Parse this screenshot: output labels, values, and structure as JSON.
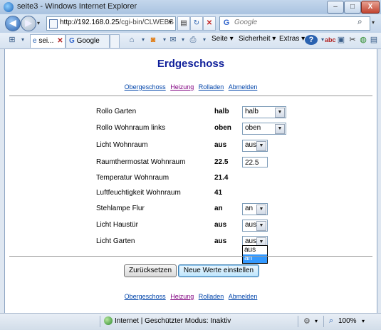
{
  "window": {
    "title": "seite3 - Windows Internet Explorer",
    "controls": {
      "minimize": "–",
      "maximize": "□",
      "close": "X"
    }
  },
  "addressbar": {
    "url_host": "http://192.168.0.25",
    "url_path": "/cgi-bin/CLWEBS",
    "search_placeholder": "Google"
  },
  "tabs": [
    {
      "label": "sei..."
    },
    {
      "label": "Google"
    }
  ],
  "commandbar": {
    "page": "Seite ▾",
    "safety": "Sicherheit ▾",
    "extras": "Extras ▾",
    "help": "?▾"
  },
  "page": {
    "heading": "Erdgeschoss",
    "nav": [
      "Obergeschoss",
      "Heizung",
      "Rolladen",
      "Abmelden"
    ],
    "rows": [
      {
        "label": "Rollo Garten",
        "value": "halb",
        "control": "select",
        "selected": "halb"
      },
      {
        "label": "Rollo Wohnraum links",
        "value": "oben",
        "control": "select",
        "selected": "oben"
      },
      {
        "label": "Licht Wohnraum",
        "value": "aus",
        "control": "select",
        "selected": "aus"
      },
      {
        "label": "Raumthermostat Wohnraum",
        "value": "22.5",
        "control": "text",
        "input_value": "22.5"
      },
      {
        "label": "Temperatur Wohnraum",
        "value": "21.4",
        "control": "none"
      },
      {
        "label": "Luftfeuchtigkeit Wohnraum",
        "value": "41",
        "control": "none"
      },
      {
        "label": "Stehlampe Flur",
        "value": "an",
        "control": "select",
        "selected": "an"
      },
      {
        "label": "Licht Haustür",
        "value": "aus",
        "control": "select",
        "selected": "aus"
      },
      {
        "label": "Licht Garten",
        "value": "aus",
        "control": "select",
        "selected": "aus"
      }
    ],
    "open_dropdown_options": [
      "aus",
      "an"
    ],
    "open_dropdown_highlighted": "an",
    "buttons": {
      "reset": "Zurücksetzen",
      "submit": "Neue Werte einstellen"
    }
  },
  "statusbar": {
    "zone_text": "Internet | Geschützter Modus: Inaktiv",
    "zoom": "100%"
  },
  "colors": {
    "heading": "#0f1f9a",
    "link": "#0044aa",
    "visited_link": "#800080",
    "highlight": "#3399ff"
  }
}
